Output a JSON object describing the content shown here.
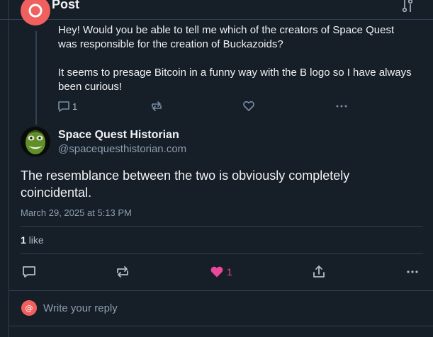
{
  "header": {
    "title": "Post",
    "back_icon": "arrow-left-icon",
    "settings_icon": "sliders-icon"
  },
  "parent_post": {
    "avatar_color": "#f0605e",
    "paragraphs": [
      "Hey!  Would you be able to tell me which of the creators of Space Quest was responsible for the creation of Buckazoids?",
      "It seems to presage Bitcoin in a funny way with the B logo so I have always been curious!"
    ],
    "reply_count": "1",
    "icons": [
      "reply-bubble-icon",
      "repost-icon",
      "heart-icon",
      "more-dots-icon"
    ]
  },
  "post": {
    "author_name": "Space Quest Historian",
    "author_handle": "@spacequesthistorian.com",
    "text": "The resemblance between the two is obviously completely coincidental.",
    "date": "March 29, 2025 at 5:13 PM",
    "likes_count": "1",
    "likes_label": " like",
    "like_count_action": "1",
    "like_color": "#ec4899"
  },
  "reply_box": {
    "placeholder": "Write your reply",
    "avatar_color": "#f0605e"
  }
}
